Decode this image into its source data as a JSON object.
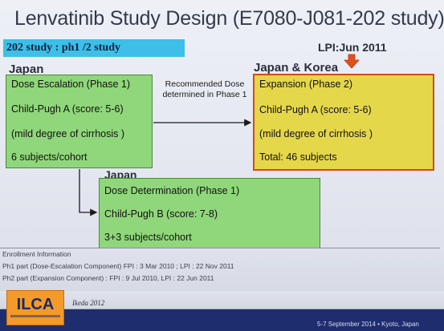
{
  "slide": {
    "title": "Lenvatinib Study Design (E7080-J081-202 study)",
    "subtitle": "202 study : ph1 /2 study",
    "lpi_label": "LPI:Jun 2011",
    "colors": {
      "subtitle_bar": "#3dbfe9",
      "green_box": "#8fd77a",
      "yellow_box": "#e5d74a",
      "highlight_border": "#d64a1a",
      "footer_band": "#1e2d6e",
      "logo": "#f39a2a"
    }
  },
  "regions": {
    "japan_1": "Japan",
    "japan_korea": "Japan & Korea",
    "japan_2": "Japan"
  },
  "escalation": {
    "heading": "Dose Escalation (Phase 1)",
    "child_pugh": "Child-Pugh A (score: 5-6)",
    "cirrhosis": "(mild degree of cirrhosis )",
    "subjects": "6 subjects/cohort"
  },
  "arrow_label": {
    "line1": "Recommended Dose",
    "line2": "determined in Phase 1"
  },
  "expansion": {
    "heading": "Expansion  (Phase 2)",
    "child_pugh": "Child-Pugh A (score: 5-6)",
    "cirrhosis": "(mild degree of cirrhosis )",
    "total": "Total: 46 subjects"
  },
  "determination": {
    "heading": "Dose Determination (Phase 1)",
    "child_pugh": "Child-Pugh B (score: 7-8)",
    "subjects": "3+3 subjects/cohort"
  },
  "enrollment": {
    "heading": "Enrollment Information",
    "ph1": "Ph1 part (Dose-Escalation Component)  FPI : 3 Mar 2010 ; LPI : 22 Nov 2011",
    "ph2": "Ph2 part (Expansion Component) : FPI : 9 Jul 2010, LPI : 22 Jun 2011"
  },
  "footer": {
    "logo": "ILCA",
    "credit": "Ikeda 2012",
    "event": "5-7 September 2014 • Kyoto, Japan"
  }
}
